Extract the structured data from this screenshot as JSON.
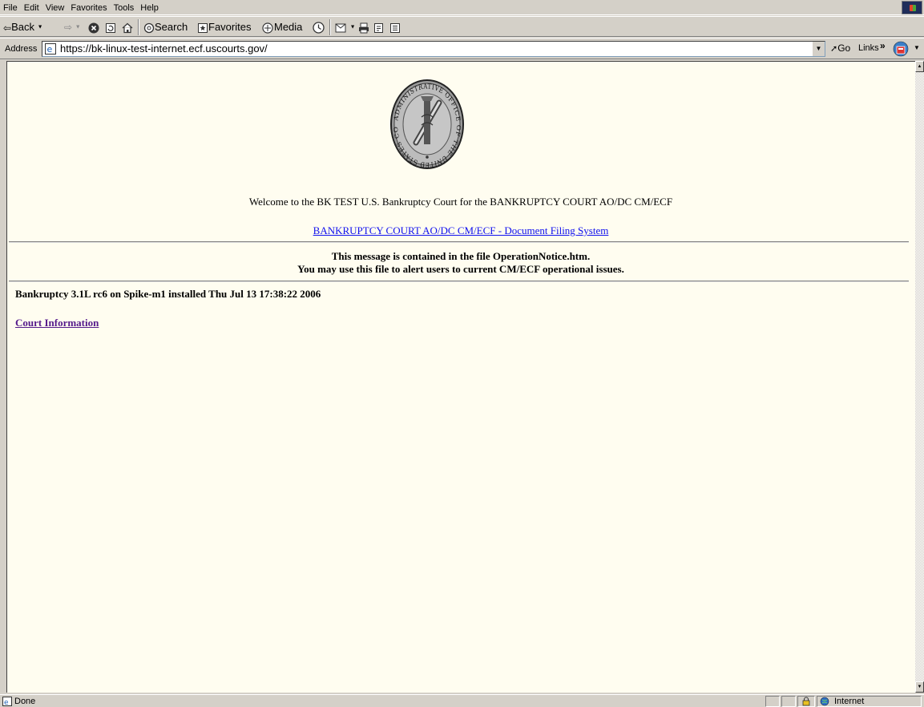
{
  "menu": [
    "File",
    "Edit",
    "View",
    "Favorites",
    "Tools",
    "Help"
  ],
  "toolbar": {
    "back": "Back",
    "search": "Search",
    "favorites": "Favorites",
    "media": "Media"
  },
  "address": {
    "label": "Address",
    "url": "https://bk-linux-test-internet.ecf.uscourts.gov/",
    "go": "Go",
    "links": "Links"
  },
  "page": {
    "seal_text": "ADMINISTRATIVE OFFICE OF THE UNITED STATES COURTS",
    "welcome": "Welcome to the BK TEST U.S. Bankruptcy Court for the BANKRUPTCY COURT AO/DC CM/ECF",
    "filing_link": "BANKRUPTCY COURT AO/DC CM/ECF - Document Filing System",
    "notice_line1": "This message is contained in the file OperationNotice.htm.",
    "notice_line2": "You may use this file to alert users to current CM/ECF operational issues.",
    "version": "Bankruptcy 3.1L rc6 on Spike-m1 installed Thu Jul 13 17:38:22 2006",
    "court_info": "Court Information"
  },
  "status": {
    "text": "Done",
    "zone": "Internet"
  },
  "colors": {
    "page_bg": "#fffdf0",
    "link": "#1010ee",
    "visited_link": "#551a8b",
    "chrome": "#d4d0c8"
  }
}
